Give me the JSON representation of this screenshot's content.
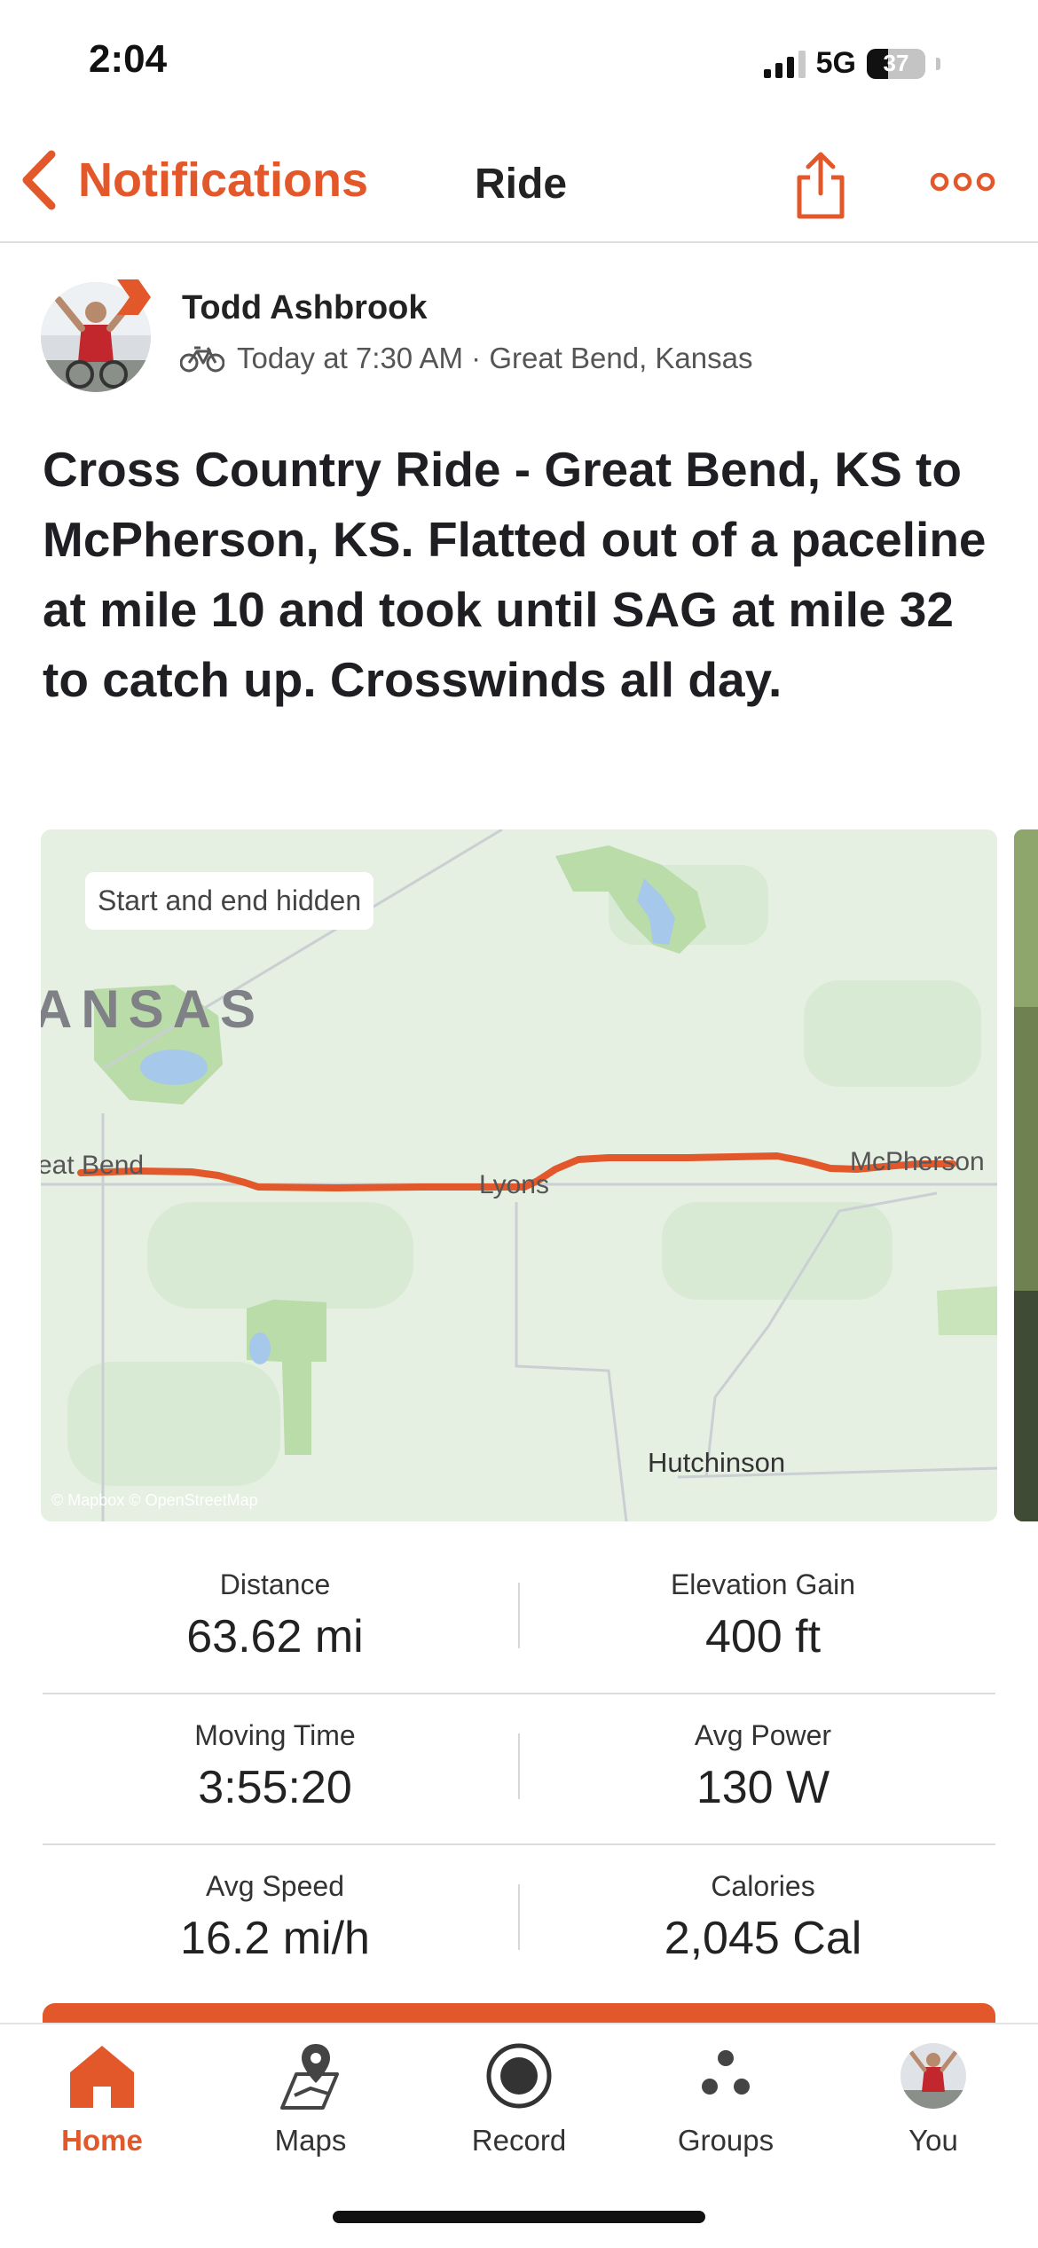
{
  "status": {
    "time": "2:04",
    "network": "5G",
    "battery": "37",
    "battery_level": 0.37
  },
  "nav": {
    "back_label": "Notifications",
    "title": "Ride",
    "share_icon": "share-icon",
    "more_icon": "more-horizontal-icon"
  },
  "activity": {
    "athlete_name": "Todd Ashbrook",
    "sport_icon": "bike-icon",
    "meta": "Today at 7:30 AM · Great Bend, Kansas",
    "description": "Cross Country Ride - Great Bend, KS to McPherson, KS. Flatted out of a paceline at mile 10 and took until SAG at mile 32 to catch up. Crosswinds all day."
  },
  "map": {
    "privacy_label": "Start and end hidden",
    "state_label": "ANSAS",
    "place_great_bend": "eat Bend",
    "place_lyons": "Lyons",
    "place_mcpherson": "McPherson",
    "place_hutchinson": "Hutchinson",
    "attribution": "© Mapbox © OpenStreetMap",
    "route_color": "#e2582a"
  },
  "stats": [
    {
      "label": "Distance",
      "value": "63.62 mi"
    },
    {
      "label": "Elevation Gain",
      "value": "400 ft"
    },
    {
      "label": "Moving Time",
      "value": "3:55:20"
    },
    {
      "label": "Avg Power",
      "value": "130 W"
    },
    {
      "label": "Avg Speed",
      "value": "16.2 mi/h"
    },
    {
      "label": "Calories",
      "value": "2,045 Cal"
    }
  ],
  "tabs": [
    {
      "label": "Home",
      "icon": "home-icon"
    },
    {
      "label": "Maps",
      "icon": "map-pin-icon"
    },
    {
      "label": "Record",
      "icon": "record-icon"
    },
    {
      "label": "Groups",
      "icon": "groups-icon"
    },
    {
      "label": "You",
      "icon": "profile-avatar"
    }
  ],
  "colors": {
    "accent": "#e2582a",
    "text": "#242428"
  }
}
